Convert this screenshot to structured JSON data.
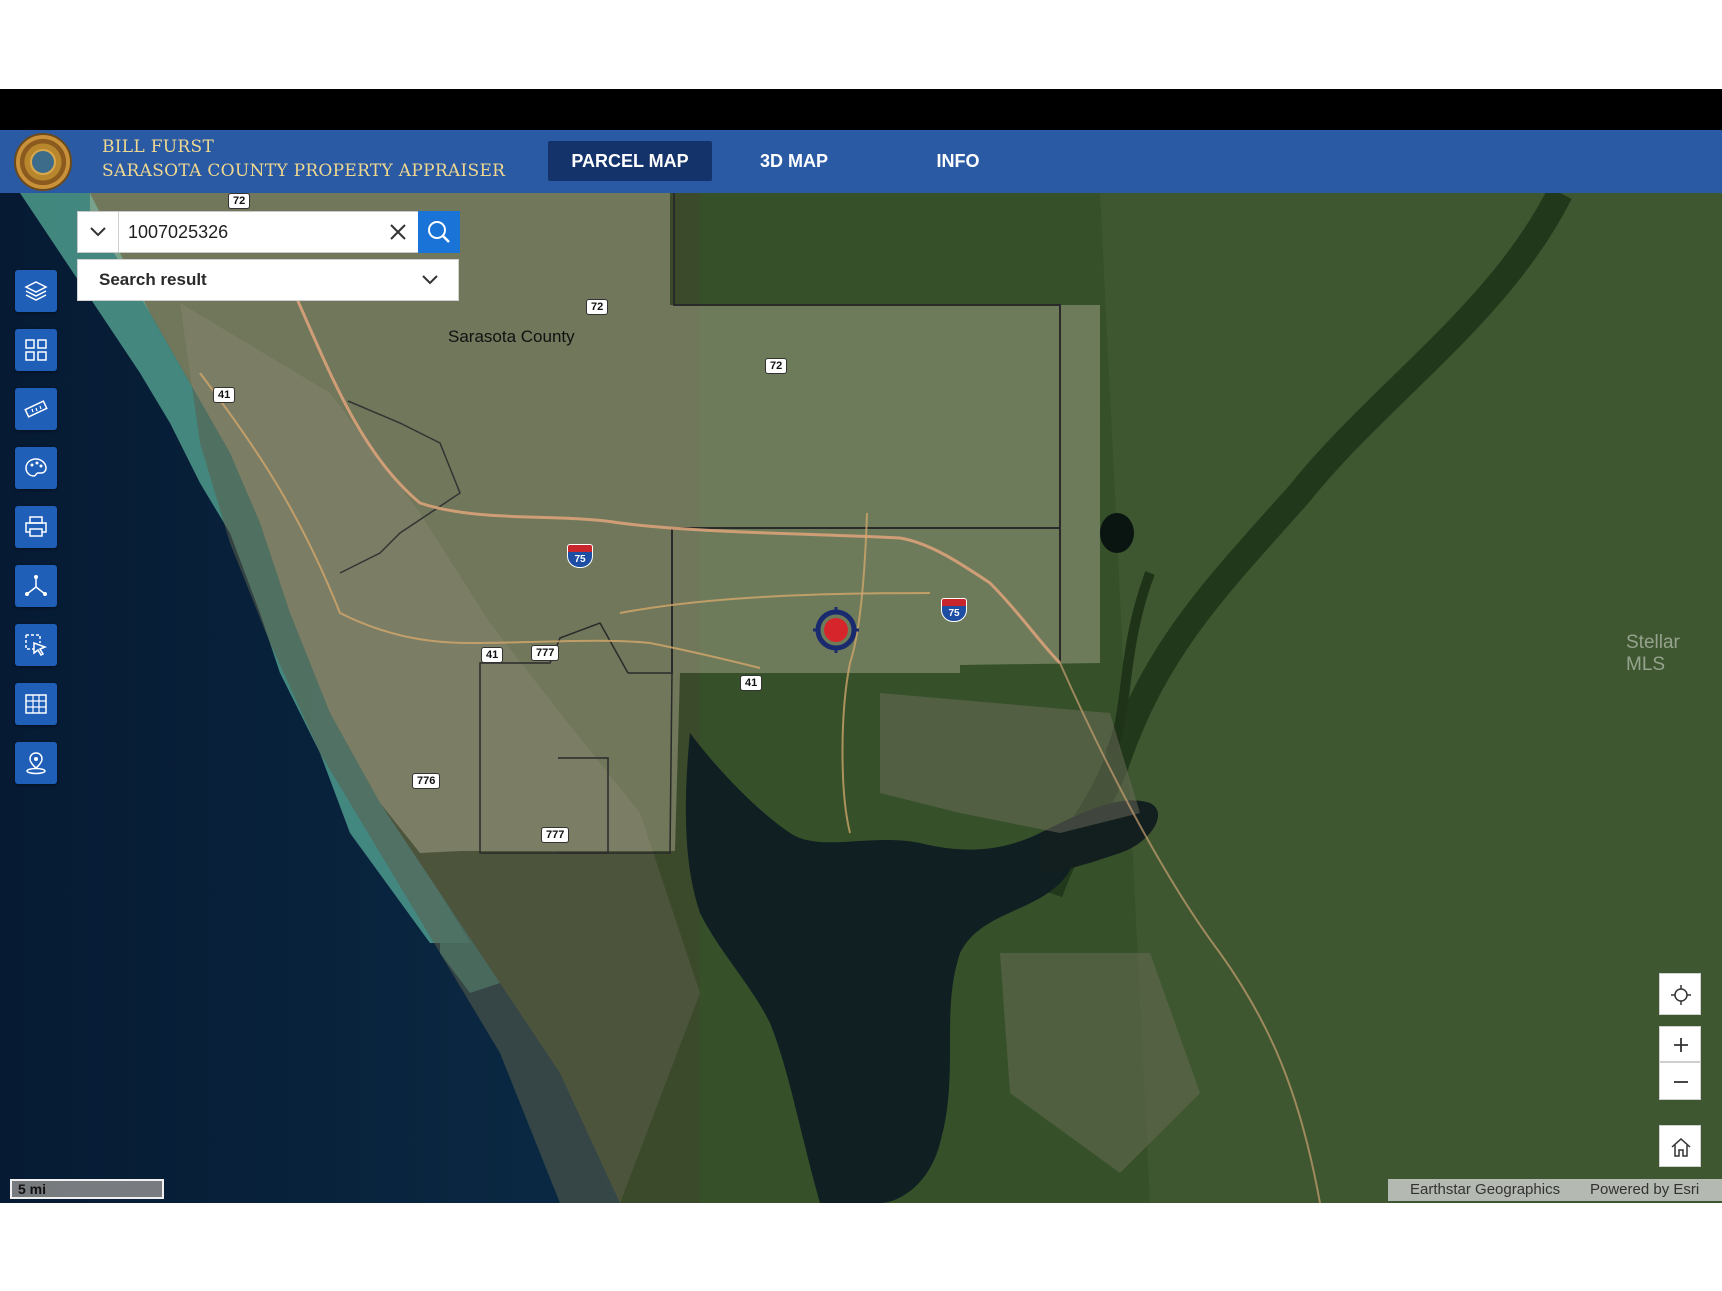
{
  "header": {
    "brand_line1": "BILL FURST",
    "brand_line2": "SARASOTA COUNTY PROPERTY APPRAISER",
    "logo": "county-seal"
  },
  "nav": {
    "tabs": [
      {
        "label": "PARCEL MAP",
        "active": true
      },
      {
        "label": "3D MAP",
        "active": false
      },
      {
        "label": "INFO",
        "active": false
      }
    ]
  },
  "search": {
    "value": "1007025326",
    "result_label": "Search result"
  },
  "toolbar": {
    "icons": [
      "layers-icon",
      "basemap-gallery-icon",
      "measure-icon",
      "draw-icon",
      "print-icon",
      "share-icon",
      "select-icon",
      "table-icon",
      "locate-pin-icon"
    ]
  },
  "map": {
    "county_label": "Sarasota County",
    "roads": {
      "r72a": "72",
      "r72b": "72",
      "r72c": "72",
      "r41a": "41",
      "r41b": "41",
      "r41c": "41",
      "r777a": "777",
      "r777b": "777",
      "r776": "776",
      "i75a": "75",
      "i75b": "75"
    },
    "watermark": "Stellar MLS"
  },
  "footer": {
    "scale": "5 mi",
    "attribution": "Earthstar Geographics",
    "powered_by": "Powered by Esri"
  },
  "colors": {
    "header_blue": "#2a5aa3",
    "active_tab": "#13336a",
    "tool_blue": "#1f5fb8",
    "search_blue": "#1a73d6"
  }
}
